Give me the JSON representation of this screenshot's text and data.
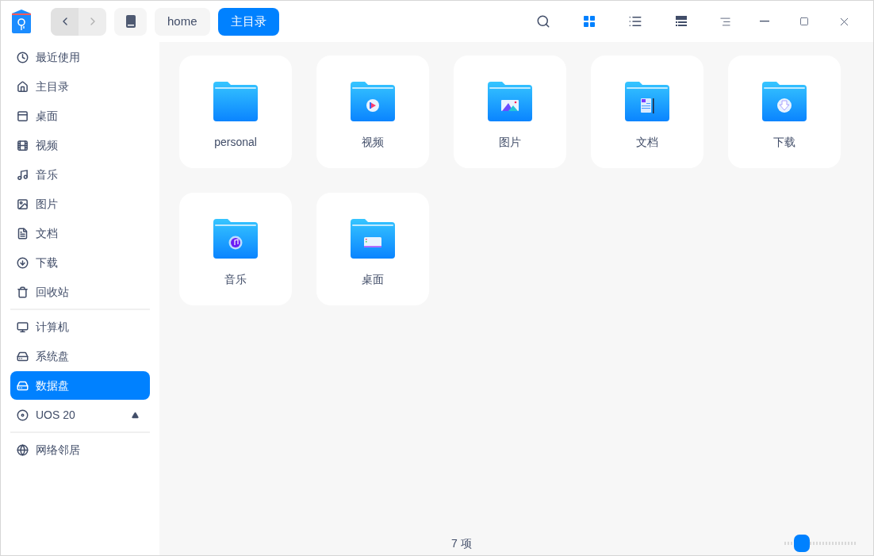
{
  "nav": {
    "back": {
      "disabled": false
    },
    "forward": {
      "disabled": true
    }
  },
  "breadcrumbs": [
    {
      "label": "home",
      "selected": false
    },
    {
      "label": "主目录",
      "selected": true
    }
  ],
  "view_modes": [
    {
      "selected": true
    },
    {
      "selected": false
    },
    {
      "selected": false
    }
  ],
  "sidebar": {
    "groups": [
      [
        {
          "label": "最近使用",
          "selected": false
        },
        {
          "label": "主目录",
          "selected": false
        },
        {
          "label": "桌面",
          "selected": false
        },
        {
          "label": "视频",
          "selected": false
        },
        {
          "label": "音乐",
          "selected": false
        },
        {
          "label": "图片",
          "selected": false
        },
        {
          "label": "文档",
          "selected": false
        },
        {
          "label": "下载",
          "selected": false
        },
        {
          "label": "回收站",
          "selected": false
        }
      ],
      [
        {
          "label": "计算机",
          "selected": false
        },
        {
          "label": "系统盘",
          "selected": false
        },
        {
          "label": "数据盘",
          "selected": true
        },
        {
          "label": "UOS 20",
          "selected": false,
          "eject": true
        }
      ],
      [
        {
          "label": "网络邻居",
          "selected": false
        }
      ]
    ]
  },
  "folders": [
    {
      "label": "personal"
    },
    {
      "label": "视频"
    },
    {
      "label": "图片"
    },
    {
      "label": "文档"
    },
    {
      "label": "下载"
    },
    {
      "label": "音乐"
    },
    {
      "label": "桌面"
    }
  ],
  "status_bar": {
    "count": "7 项",
    "zoom": {
      "level": 0.24
    }
  }
}
